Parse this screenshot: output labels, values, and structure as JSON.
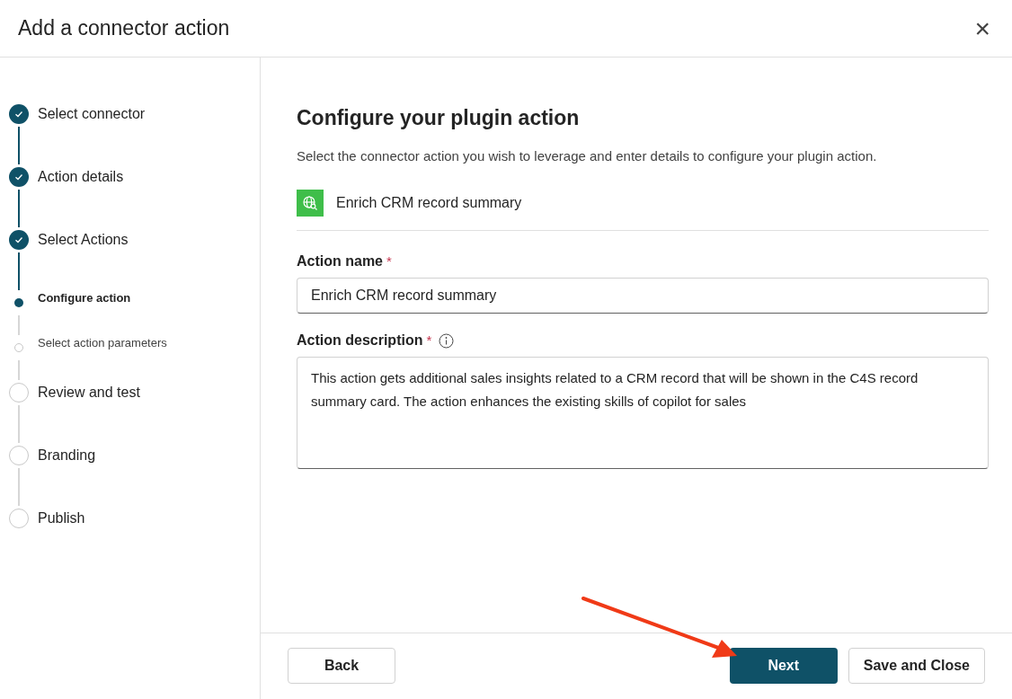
{
  "window": {
    "title": "Add a connector action",
    "close": "×"
  },
  "steps": [
    {
      "label": "Select connector",
      "kind": "step",
      "completed": true,
      "current": false
    },
    {
      "label": "Action details",
      "kind": "step",
      "completed": true,
      "current": false
    },
    {
      "label": "Select Actions",
      "kind": "step",
      "completed": true,
      "current": false
    },
    {
      "label": "Configure action",
      "kind": "substep",
      "completed": false,
      "current": true
    },
    {
      "label": "Select action parameters",
      "kind": "substep",
      "completed": false,
      "current": false
    },
    {
      "label": "Review and test",
      "kind": "step",
      "completed": false,
      "current": false
    },
    {
      "label": "Branding",
      "kind": "step",
      "completed": false,
      "current": false
    },
    {
      "label": "Publish",
      "kind": "step",
      "completed": false,
      "current": false
    }
  ],
  "content": {
    "heading": "Configure your plugin action",
    "description": "Select the connector action you wish to leverage and enter details to configure your plugin action.",
    "action": {
      "name": "Enrich CRM record summary"
    },
    "fields": [
      {
        "kind": "input",
        "label": "Action name",
        "required_mark": "*",
        "info": false,
        "value": "Enrich CRM record summary"
      },
      {
        "kind": "textarea",
        "label": "Action description",
        "required_mark": "*",
        "info": true,
        "value": "This action gets additional sales insights related to a CRM record that will be shown in the C4S record summary card. The action enhances the existing skills of copilot for sales"
      }
    ]
  },
  "footer": {
    "buttons": [
      {
        "label": "Back",
        "kind": "secondary"
      },
      {
        "label": "Next",
        "kind": "primary"
      },
      {
        "label": "Save and Close",
        "kind": "secondary"
      }
    ]
  }
}
